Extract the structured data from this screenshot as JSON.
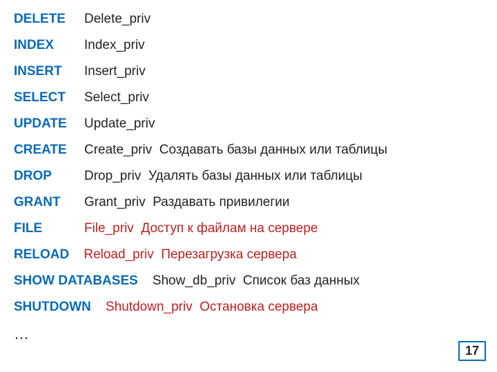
{
  "rows": [
    {
      "kw": "DELETE",
      "col": "Delete_priv",
      "col_red": false,
      "desc": "",
      "desc_red": false,
      "kw_wide": false
    },
    {
      "kw": "INDEX",
      "col": "Index_priv",
      "col_red": false,
      "desc": "",
      "desc_red": false,
      "kw_wide": false
    },
    {
      "kw": "INSERT",
      "col": "Insert_priv",
      "col_red": false,
      "desc": "",
      "desc_red": false,
      "kw_wide": false
    },
    {
      "kw": "SELECT",
      "col": "Select_priv",
      "col_red": false,
      "desc": "",
      "desc_red": false,
      "kw_wide": false
    },
    {
      "kw": "UPDATE",
      "col": "Update_priv",
      "col_red": false,
      "desc": "",
      "desc_red": false,
      "kw_wide": false
    },
    {
      "kw": "CREATE",
      "col": "Create_priv",
      "col_red": false,
      "desc": "Создавать базы данных или таблицы",
      "desc_red": false,
      "kw_wide": false
    },
    {
      "kw": "DROP",
      "col": "Drop_priv",
      "col_red": false,
      "desc": "Удалять базы данных или таблицы",
      "desc_red": false,
      "kw_wide": false
    },
    {
      "kw": "GRANT",
      "col": "Grant_priv",
      "col_red": false,
      "desc": "Раздавать привилегии",
      "desc_red": false,
      "kw_wide": false
    },
    {
      "kw": "FILE",
      "col": "File_priv",
      "col_red": true,
      "desc": "Доступ к файлам на сервере",
      "desc_red": true,
      "kw_wide": false
    },
    {
      "kw": "RELOAD",
      "col": "Reload_priv",
      "col_red": true,
      "desc": "Перезагрузка сервера",
      "desc_red": true,
      "kw_wide": true
    },
    {
      "kw": "SHOW DATABASES",
      "col": "Show_db_priv",
      "col_red": false,
      "desc": "Список баз данных",
      "desc_red": false,
      "kw_wide": true
    },
    {
      "kw": "SHUTDOWN",
      "col": "Shutdown_priv",
      "col_red": true,
      "desc": "Остановка сервера",
      "desc_red": true,
      "kw_wide": true
    }
  ],
  "ellipsis": "…",
  "page_number": "17"
}
